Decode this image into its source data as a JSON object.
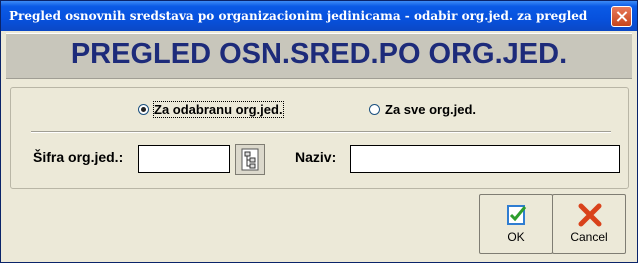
{
  "window": {
    "title": "Pregled osnovnih sredstava po organizacionim jedinicama - odabir org.jed. za pregled"
  },
  "banner": {
    "heading": "PREGLED OSN.SRED.PO ORG.JED."
  },
  "scope": {
    "options": [
      {
        "label": "Za odabranu org.jed.",
        "checked": true
      },
      {
        "label": "Za sve org.jed.",
        "checked": false
      }
    ]
  },
  "form": {
    "code_label": "Šifra org.jed.:",
    "code_value": "",
    "name_label": "Naziv:",
    "name_value": ""
  },
  "buttons": {
    "ok_label": "OK",
    "cancel_label": "Cancel"
  },
  "colors": {
    "title_bar": "#0751dd",
    "banner_text": "#1d2b7a",
    "cancel_icon": "#d9421b",
    "ok_icon": "#2f7dd1"
  }
}
